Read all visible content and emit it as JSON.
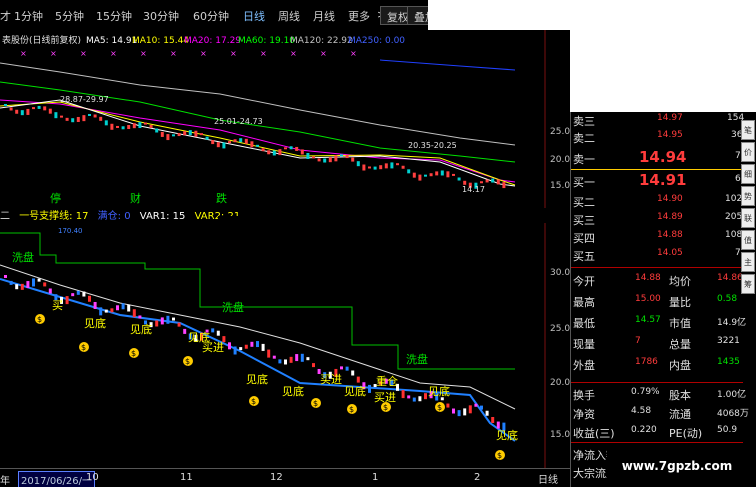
{
  "toolbar": {
    "periods": [
      "1分钟",
      "5分钟",
      "15分钟",
      "30分钟",
      "60分钟",
      "日线",
      "周线",
      "月线",
      "更多"
    ],
    "active_period": "日线",
    "more_arrow": ">",
    "restore_button": "复权",
    "overlay_button": "叠加",
    "left_cut": "才"
  },
  "ma_legend": {
    "stock_title": "表股份(日线前复权)",
    "ma5": "MA5: 14.91",
    "ma10": "MA10: 15.44",
    "ma20": "MA20: 17.29",
    "ma60": "MA60: 19.10",
    "ma120": "MA120: 22.92",
    "ma250": "MA250: 0.00",
    "colors": {
      "ma5": "#ffffff",
      "ma10": "#ffff00",
      "ma20": "#ff00ff",
      "ma60": "#00ff00",
      "ma120": "#c0c0c0",
      "ma250": "#4060ff"
    }
  },
  "top_chart": {
    "price_ticks": [
      "25.00",
      "20.00",
      "15.00"
    ],
    "annotations": [
      "28.87-29.97",
      "25.01-24.73",
      "20.35-20.25",
      "14.17"
    ],
    "event_labels": [
      "停",
      "财",
      "跌"
    ]
  },
  "indicator": {
    "label_prefix": "二",
    "support_line": "一号支撑线: 17",
    "pixel_label": "满仓: 0",
    "var1": "VAR1: 15",
    "var2": "VAR2: 21"
  },
  "bottom_chart": {
    "price_ticks": [
      "30.00",
      "25.00",
      "20.00",
      "15.00"
    ],
    "wash_labels": [
      "洗盘",
      "洗盘",
      "洗盘"
    ],
    "see_bottom_labels": [
      "见底",
      "见底",
      "见底",
      "见底",
      "见底",
      "见底",
      "见底",
      "见底"
    ],
    "buy_labels": [
      "买",
      "买进",
      "买进",
      "买进"
    ],
    "buy_heavy_labels": [
      "重仓"
    ],
    "money_icon_text": "$",
    "top_left_label": "170.40"
  },
  "x_axis": {
    "left_cut": "年",
    "date_box": "2017/06/26/一",
    "months": [
      "10",
      "11",
      "12",
      "1",
      "2"
    ],
    "period_label": "日线"
  },
  "quote": {
    "ask_rows": [
      {
        "label": "卖三",
        "price": "14.97",
        "volume": "154"
      },
      {
        "label": "卖二",
        "price": "14.95",
        "volume": "36"
      },
      {
        "label": "卖一",
        "price": "14.94",
        "volume": "7"
      }
    ],
    "bid_rows": [
      {
        "label": "买一",
        "price": "14.91",
        "volume": "6"
      },
      {
        "label": "买二",
        "price": "14.90",
        "volume": "102"
      },
      {
        "label": "买三",
        "price": "14.89",
        "volume": "205"
      },
      {
        "label": "买四",
        "price": "14.88",
        "volume": "108"
      },
      {
        "label": "买五",
        "price": "14.05",
        "volume": "7"
      }
    ],
    "stats": [
      {
        "l1": "今开",
        "v1": "14.88",
        "c1": "red",
        "l2": "均价",
        "v2": "14.86",
        "c2": "red"
      },
      {
        "l1": "最高",
        "v1": "15.00",
        "c1": "red",
        "l2": "量比",
        "v2": "0.58",
        "c2": "green"
      },
      {
        "l1": "最低",
        "v1": "14.57",
        "c1": "green",
        "l2": "市值",
        "v2": "14.9亿",
        "c2": "white"
      },
      {
        "l1": "现量",
        "v1": "7",
        "c1": "red",
        "l2": "总量",
        "v2": "3221",
        "c2": "white"
      },
      {
        "l1": "外盘",
        "v1": "1786",
        "c1": "red",
        "l2": "内盘",
        "v2": "1435",
        "c2": "green"
      }
    ],
    "fund_rows": [
      {
        "l1": "换手",
        "v1": "0.79%",
        "l2": "股本",
        "v2": "1.00亿"
      },
      {
        "l1": "净资",
        "v1": "4.58",
        "l2": "流通",
        "v2": "4068万"
      },
      {
        "l1": "收益(三)",
        "v1": "0.220",
        "l2": "PE(动)",
        "v2": "50.9"
      }
    ],
    "extra_rows": [
      "净流入额",
      "大宗流入"
    ],
    "side_tabs": [
      "笔",
      "价",
      "细",
      "势",
      "联",
      "值",
      "主",
      "筹"
    ]
  },
  "watermark": "www.7gpzb.com"
}
